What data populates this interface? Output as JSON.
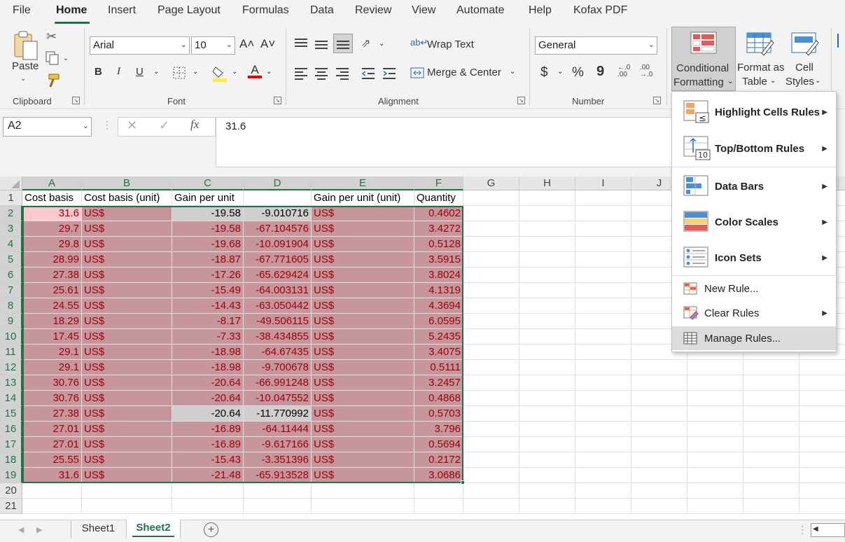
{
  "menu": [
    "File",
    "Home",
    "Insert",
    "Page Layout",
    "Formulas",
    "Data",
    "Review",
    "View",
    "Automate",
    "Help",
    "Kofax PDF"
  ],
  "ribbon": {
    "clipboard": {
      "label": "Clipboard",
      "paste": "Paste"
    },
    "font": {
      "label": "Font",
      "name": "Arial",
      "size": "10",
      "bold": "B",
      "italic": "I",
      "underline": "U",
      "grow": "A˄",
      "shrink": "A˅",
      "font_color_letter": "A"
    },
    "alignment": {
      "label": "Alignment",
      "wrap_text": "Wrap Text",
      "merge_center": "Merge & Center"
    },
    "number": {
      "label": "Number",
      "format": "General",
      "currency": "$",
      "percent": "%",
      "comma": "9",
      "inc_decimal": "←.0\n.00",
      "dec_decimal": ".00\n→.0"
    },
    "styles": {
      "conditional_formatting": [
        "Conditional",
        "Formatting"
      ],
      "format_as_table": [
        "Format as",
        "Table"
      ],
      "cell_styles": [
        "Cell",
        "Styles"
      ]
    }
  },
  "formula_bar": {
    "name_box": "A2",
    "fx": "fx",
    "value": "31.6"
  },
  "columns": [
    "A",
    "B",
    "C",
    "D",
    "E",
    "F",
    "G",
    "H",
    "I",
    "J"
  ],
  "header_row": [
    "Cost basis",
    "Cost basis (unit)",
    "Gain per unit",
    "",
    "Gain per unit (unit)",
    "Quantity"
  ],
  "rows": [
    [
      "31.6",
      "US$",
      "-19.58",
      "-9.010716",
      "US$",
      "0.4602"
    ],
    [
      "29.7",
      "US$",
      "-19.58",
      "-67.104576",
      "US$",
      "3.4272"
    ],
    [
      "29.8",
      "US$",
      "-19.68",
      "-10.091904",
      "US$",
      "0.5128"
    ],
    [
      "28.99",
      "US$",
      "-18.87",
      "-67.771605",
      "US$",
      "3.5915"
    ],
    [
      "27.38",
      "US$",
      "-17.26",
      "-65.629424",
      "US$",
      "3.8024"
    ],
    [
      "25.61",
      "US$",
      "-15.49",
      "-64.003131",
      "US$",
      "4.1319"
    ],
    [
      "24.55",
      "US$",
      "-14.43",
      "-63.050442",
      "US$",
      "4.3694"
    ],
    [
      "18.29",
      "US$",
      "-8.17",
      "-49.506115",
      "US$",
      "6.0595"
    ],
    [
      "17.45",
      "US$",
      "-7.33",
      "-38.434855",
      "US$",
      "5.2435"
    ],
    [
      "29.1",
      "US$",
      "-18.98",
      "-64.67435",
      "US$",
      "3.4075"
    ],
    [
      "29.1",
      "US$",
      "-18.98",
      "-9.700678",
      "US$",
      "0.5111"
    ],
    [
      "30.76",
      "US$",
      "-20.64",
      "-66.991248",
      "US$",
      "3.2457"
    ],
    [
      "30.76",
      "US$",
      "-20.64",
      "-10.047552",
      "US$",
      "0.4868"
    ],
    [
      "27.38",
      "US$",
      "-20.64",
      "-11.770992",
      "US$",
      "0.5703"
    ],
    [
      "27.01",
      "US$",
      "-16.89",
      "-64.11444",
      "US$",
      "3.796"
    ],
    [
      "27.01",
      "US$",
      "-16.89",
      "-9.617166",
      "US$",
      "0.5694"
    ],
    [
      "25.55",
      "US$",
      "-15.43",
      "-3.351396",
      "US$",
      "0.2172"
    ],
    [
      "31.6",
      "US$",
      "-21.48",
      "-65.913528",
      "US$",
      "3.0686"
    ]
  ],
  "row_numbers": [
    "1",
    "2",
    "3",
    "4",
    "5",
    "6",
    "7",
    "8",
    "9",
    "10",
    "11",
    "12",
    "13",
    "14",
    "15",
    "16",
    "17",
    "18",
    "19",
    "20",
    "21"
  ],
  "sheets": {
    "tabs": [
      "Sheet1",
      "Sheet2"
    ],
    "active": "Sheet2",
    "add": "+"
  },
  "cf_menu": {
    "items": [
      {
        "label": "Highlight Cells Rules",
        "submenu": true
      },
      {
        "label": "Top/Bottom Rules",
        "submenu": true
      },
      {
        "label": "Data Bars",
        "submenu": true
      },
      {
        "label": "Color Scales",
        "submenu": true
      },
      {
        "label": "Icon Sets",
        "submenu": true
      }
    ],
    "actions": [
      {
        "label": "New Rule...",
        "submenu": false
      },
      {
        "label": "Clear Rules",
        "submenu": true
      },
      {
        "label": "Manage Rules...",
        "submenu": false
      }
    ]
  },
  "colors": {
    "accent": "#217346",
    "highlight_fill": "#c7969d",
    "highlight_text": "#9c0006",
    "active_cell_fill": "#ffc7ce",
    "grey_fill": "#cfcfcf"
  }
}
